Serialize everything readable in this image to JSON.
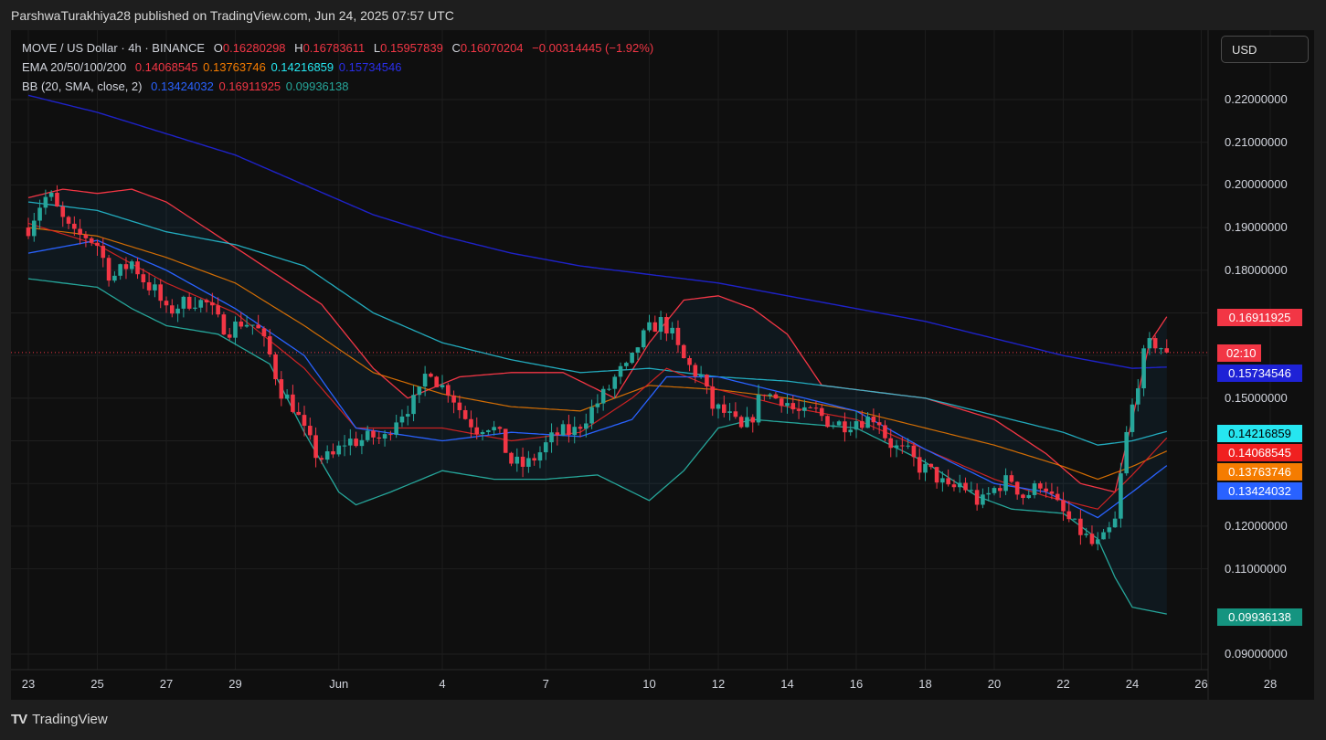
{
  "header": {
    "text": "ParshwaTurakhiya28 published on TradingView.com, Jun 24, 2025 07:57 UTC"
  },
  "legend": {
    "symbol": "MOVE / US Dollar · 4h · BINANCE",
    "open_label": "O",
    "open": "0.16280298",
    "high_label": "H",
    "high": "0.16783611",
    "low_label": "L",
    "low": "0.15957839",
    "close_label": "C",
    "close": "0.16070204",
    "change": "−0.00314445 (−1.92%)",
    "ema_label": "EMA 20/50/100/200",
    "ema20": "0.14068545",
    "ema50": "0.13763746",
    "ema100": "0.14216859",
    "ema200": "0.15734546",
    "bb_label": "BB (20, SMA, close, 2)",
    "bb_basis": "0.13424032",
    "bb_upper": "0.16911925",
    "bb_lower": "0.09936138"
  },
  "currency_button": "USD",
  "footer": {
    "logo": "TV",
    "brand": "TradingView"
  },
  "colors": {
    "background": "#0f0f0f",
    "up": "#26a69a",
    "down": "#f23645",
    "ema20": "#e02424",
    "ema50": "#f57c00",
    "ema100": "#26c6da",
    "ema200": "#1e22c8",
    "bb_basis": "#2962ff",
    "bb_upper": "#f23645",
    "bb_lower": "#26a69a"
  },
  "price_labels": [
    {
      "text": "0.16911925",
      "bg": "#f23645",
      "fg": "#ffffff",
      "value": 0.16911925
    },
    {
      "text": "02:10",
      "bg": "#f23645",
      "fg": "#ffffff",
      "value": 0.1607
    },
    {
      "text": "0.15734546",
      "bg": "#1e22d6",
      "fg": "#ffffff",
      "value": 0.15734546
    },
    {
      "text": "0.14216859",
      "bg": "#26e6f0",
      "fg": "#000000",
      "value": 0.14216859
    },
    {
      "text": "0.14068545",
      "bg": "#f02020",
      "fg": "#ffffff",
      "value": 0.14068545
    },
    {
      "text": "0.13763746",
      "bg": "#f57c00",
      "fg": "#ffffff",
      "value": 0.13763746
    },
    {
      "text": "0.13424032",
      "bg": "#2962ff",
      "fg": "#ffffff",
      "value": 0.13424032
    },
    {
      "text": "0.09936138",
      "bg": "#159480",
      "fg": "#ffffff",
      "value": 0.09936138
    }
  ],
  "chart_data": {
    "type": "candlestick",
    "y_ticks": [
      {
        "value": 0.22,
        "label": "0.22000000"
      },
      {
        "value": 0.21,
        "label": "0.21000000"
      },
      {
        "value": 0.2,
        "label": "0.20000000"
      },
      {
        "value": 0.19,
        "label": "0.19000000"
      },
      {
        "value": 0.18,
        "label": "0.18000000"
      },
      {
        "value": 0.15,
        "label": "0.15000000"
      },
      {
        "value": 0.12,
        "label": "0.12000000"
      },
      {
        "value": 0.11,
        "label": "0.11000000"
      },
      {
        "value": 0.09,
        "label": "0.09000000"
      }
    ],
    "ylim": [
      0.0862,
      0.2267
    ],
    "x_ticks": [
      {
        "day": 0,
        "label": "23"
      },
      {
        "day": 2,
        "label": "25"
      },
      {
        "day": 4,
        "label": "27"
      },
      {
        "day": 6,
        "label": "29"
      },
      {
        "day": 9,
        "label": "Jun"
      },
      {
        "day": 12,
        "label": "4"
      },
      {
        "day": 15,
        "label": "7"
      },
      {
        "day": 18,
        "label": "10"
      },
      {
        "day": 20,
        "label": "12"
      },
      {
        "day": 22,
        "label": "14"
      },
      {
        "day": 24,
        "label": "16"
      },
      {
        "day": 26,
        "label": "18"
      },
      {
        "day": 28,
        "label": "20"
      },
      {
        "day": 30,
        "label": "22"
      },
      {
        "day": 32,
        "label": "24"
      },
      {
        "day": 34,
        "label": "26"
      },
      {
        "day": 36,
        "label": "28"
      }
    ],
    "xlim_days": [
      -0.2,
      38.5
    ],
    "current_price": 0.1607,
    "closes_daily_4h_anchor": [
      [
        0.0,
        0.19
      ],
      [
        0.3,
        0.195
      ],
      [
        0.6,
        0.198
      ],
      [
        0.9,
        0.193
      ],
      [
        1.3,
        0.188
      ],
      [
        1.7,
        0.188
      ],
      [
        2.0,
        0.186
      ],
      [
        2.4,
        0.178
      ],
      [
        2.7,
        0.18
      ],
      [
        3.0,
        0.182
      ],
      [
        3.4,
        0.177
      ],
      [
        3.7,
        0.175
      ],
      [
        4.0,
        0.17
      ],
      [
        4.4,
        0.172
      ],
      [
        4.8,
        0.173
      ],
      [
        5.2,
        0.172
      ],
      [
        5.5,
        0.168
      ],
      [
        5.8,
        0.166
      ],
      [
        6.2,
        0.168
      ],
      [
        6.6,
        0.167
      ],
      [
        7.0,
        0.16
      ],
      [
        7.3,
        0.152
      ],
      [
        7.7,
        0.148
      ],
      [
        8.0,
        0.142
      ],
      [
        8.4,
        0.136
      ],
      [
        8.8,
        0.136
      ],
      [
        9.2,
        0.14
      ],
      [
        9.6,
        0.14
      ],
      [
        10.0,
        0.141
      ],
      [
        10.3,
        0.14
      ],
      [
        10.6,
        0.145
      ],
      [
        11.0,
        0.148
      ],
      [
        11.3,
        0.15
      ],
      [
        11.6,
        0.158
      ],
      [
        11.9,
        0.153
      ],
      [
        12.2,
        0.152
      ],
      [
        12.6,
        0.146
      ],
      [
        13.0,
        0.143
      ],
      [
        13.3,
        0.144
      ],
      [
        13.6,
        0.142
      ],
      [
        14.0,
        0.135
      ],
      [
        14.4,
        0.134
      ],
      [
        14.8,
        0.137
      ],
      [
        15.1,
        0.14
      ],
      [
        15.4,
        0.142
      ],
      [
        15.8,
        0.142
      ],
      [
        16.1,
        0.145
      ],
      [
        16.4,
        0.148
      ],
      [
        16.8,
        0.152
      ],
      [
        17.1,
        0.156
      ],
      [
        17.4,
        0.157
      ],
      [
        17.7,
        0.163
      ],
      [
        18.0,
        0.166
      ],
      [
        18.3,
        0.168
      ],
      [
        18.6,
        0.166
      ],
      [
        18.9,
        0.16
      ],
      [
        19.2,
        0.157
      ],
      [
        19.5,
        0.155
      ],
      [
        19.8,
        0.148
      ],
      [
        20.1,
        0.147
      ],
      [
        20.4,
        0.145
      ],
      [
        20.7,
        0.142
      ],
      [
        21.0,
        0.146
      ],
      [
        21.3,
        0.152
      ],
      [
        21.6,
        0.15
      ],
      [
        21.9,
        0.15
      ],
      [
        22.2,
        0.147
      ],
      [
        22.5,
        0.146
      ],
      [
        22.8,
        0.147
      ],
      [
        23.1,
        0.145
      ],
      [
        23.4,
        0.144
      ],
      [
        23.7,
        0.144
      ],
      [
        24.0,
        0.145
      ],
      [
        24.3,
        0.145
      ],
      [
        24.6,
        0.146
      ],
      [
        24.9,
        0.14
      ],
      [
        25.2,
        0.138
      ],
      [
        25.5,
        0.137
      ],
      [
        25.8,
        0.134
      ],
      [
        26.1,
        0.133
      ],
      [
        26.4,
        0.131
      ],
      [
        26.7,
        0.128
      ],
      [
        27.0,
        0.13
      ],
      [
        27.3,
        0.128
      ],
      [
        27.6,
        0.125
      ],
      [
        27.9,
        0.128
      ],
      [
        28.2,
        0.13
      ],
      [
        28.5,
        0.131
      ],
      [
        28.8,
        0.127
      ],
      [
        29.1,
        0.128
      ],
      [
        29.4,
        0.131
      ],
      [
        29.7,
        0.126
      ],
      [
        30.0,
        0.123
      ],
      [
        30.3,
        0.12
      ],
      [
        30.6,
        0.118
      ],
      [
        30.9,
        0.115
      ],
      [
        31.2,
        0.117
      ],
      [
        31.5,
        0.121
      ],
      [
        31.8,
        0.14
      ],
      [
        32.1,
        0.152
      ],
      [
        32.4,
        0.162
      ],
      [
        32.7,
        0.163
      ],
      [
        33.0,
        0.1607
      ]
    ],
    "ema200": [
      [
        0.0,
        0.221
      ],
      [
        2.0,
        0.217
      ],
      [
        4.0,
        0.212
      ],
      [
        6.0,
        0.207
      ],
      [
        8.0,
        0.2
      ],
      [
        10.0,
        0.193
      ],
      [
        12.0,
        0.188
      ],
      [
        14.0,
        0.184
      ],
      [
        16.0,
        0.181
      ],
      [
        18.0,
        0.179
      ],
      [
        20.0,
        0.177
      ],
      [
        22.0,
        0.174
      ],
      [
        24.0,
        0.171
      ],
      [
        26.0,
        0.168
      ],
      [
        28.0,
        0.164
      ],
      [
        30.0,
        0.16
      ],
      [
        32.0,
        0.157
      ],
      [
        33.0,
        0.1573
      ]
    ],
    "ema100": [
      [
        0.0,
        0.196
      ],
      [
        2.0,
        0.194
      ],
      [
        4.0,
        0.189
      ],
      [
        6.0,
        0.186
      ],
      [
        8.0,
        0.181
      ],
      [
        10.0,
        0.17
      ],
      [
        12.0,
        0.163
      ],
      [
        14.0,
        0.159
      ],
      [
        16.0,
        0.156
      ],
      [
        18.0,
        0.157
      ],
      [
        20.0,
        0.155
      ],
      [
        22.0,
        0.154
      ],
      [
        24.0,
        0.152
      ],
      [
        26.0,
        0.15
      ],
      [
        28.0,
        0.146
      ],
      [
        30.0,
        0.142
      ],
      [
        31.0,
        0.139
      ],
      [
        32.0,
        0.14
      ],
      [
        33.0,
        0.1422
      ]
    ],
    "ema50": [
      [
        0.0,
        0.19
      ],
      [
        2.0,
        0.188
      ],
      [
        4.0,
        0.183
      ],
      [
        6.0,
        0.177
      ],
      [
        8.0,
        0.167
      ],
      [
        10.0,
        0.156
      ],
      [
        12.0,
        0.151
      ],
      [
        14.0,
        0.148
      ],
      [
        16.0,
        0.147
      ],
      [
        18.0,
        0.153
      ],
      [
        20.0,
        0.152
      ],
      [
        22.0,
        0.15
      ],
      [
        24.0,
        0.147
      ],
      [
        26.0,
        0.143
      ],
      [
        28.0,
        0.139
      ],
      [
        30.0,
        0.134
      ],
      [
        31.0,
        0.131
      ],
      [
        32.0,
        0.134
      ],
      [
        33.0,
        0.1376
      ]
    ],
    "ema20": [
      [
        0.0,
        0.191
      ],
      [
        2.0,
        0.186
      ],
      [
        4.0,
        0.177
      ],
      [
        6.0,
        0.17
      ],
      [
        8.0,
        0.157
      ],
      [
        9.5,
        0.143
      ],
      [
        12.0,
        0.143
      ],
      [
        14.0,
        0.14
      ],
      [
        16.0,
        0.142
      ],
      [
        17.5,
        0.15
      ],
      [
        18.5,
        0.157
      ],
      [
        20.0,
        0.152
      ],
      [
        22.0,
        0.148
      ],
      [
        24.0,
        0.145
      ],
      [
        26.0,
        0.138
      ],
      [
        28.0,
        0.131
      ],
      [
        29.5,
        0.127
      ],
      [
        31.0,
        0.124
      ],
      [
        32.0,
        0.132
      ],
      [
        33.0,
        0.1407
      ]
    ],
    "bb_basis": [
      [
        0.0,
        0.184
      ],
      [
        2.0,
        0.187
      ],
      [
        4.0,
        0.18
      ],
      [
        6.0,
        0.171
      ],
      [
        8.0,
        0.16
      ],
      [
        9.5,
        0.143
      ],
      [
        12.0,
        0.14
      ],
      [
        14.0,
        0.142
      ],
      [
        16.0,
        0.141
      ],
      [
        17.5,
        0.145
      ],
      [
        18.5,
        0.155
      ],
      [
        20.0,
        0.155
      ],
      [
        22.0,
        0.151
      ],
      [
        24.0,
        0.147
      ],
      [
        26.0,
        0.138
      ],
      [
        28.0,
        0.13
      ],
      [
        29.5,
        0.128
      ],
      [
        31.0,
        0.122
      ],
      [
        32.0,
        0.128
      ],
      [
        33.0,
        0.1342
      ]
    ],
    "bb_upper": [
      [
        0.0,
        0.197
      ],
      [
        1.0,
        0.199
      ],
      [
        2.0,
        0.198
      ],
      [
        3.0,
        0.199
      ],
      [
        4.0,
        0.196
      ],
      [
        5.5,
        0.188
      ],
      [
        7.0,
        0.18
      ],
      [
        8.5,
        0.172
      ],
      [
        10.0,
        0.157
      ],
      [
        11.0,
        0.15
      ],
      [
        12.5,
        0.155
      ],
      [
        14.0,
        0.156
      ],
      [
        15.5,
        0.156
      ],
      [
        17.0,
        0.15
      ],
      [
        18.0,
        0.163
      ],
      [
        19.0,
        0.173
      ],
      [
        20.0,
        0.174
      ],
      [
        21.0,
        0.171
      ],
      [
        22.0,
        0.165
      ],
      [
        23.0,
        0.153
      ],
      [
        24.0,
        0.152
      ],
      [
        26.0,
        0.15
      ],
      [
        28.0,
        0.145
      ],
      [
        29.5,
        0.137
      ],
      [
        30.5,
        0.13
      ],
      [
        31.5,
        0.128
      ],
      [
        32.0,
        0.145
      ],
      [
        32.5,
        0.163
      ],
      [
        33.0,
        0.1691
      ]
    ],
    "bb_lower": [
      [
        0.0,
        0.178
      ],
      [
        1.0,
        0.177
      ],
      [
        2.0,
        0.176
      ],
      [
        3.0,
        0.171
      ],
      [
        4.0,
        0.167
      ],
      [
        5.5,
        0.165
      ],
      [
        7.0,
        0.158
      ],
      [
        8.0,
        0.142
      ],
      [
        9.0,
        0.128
      ],
      [
        9.5,
        0.125
      ],
      [
        10.5,
        0.128
      ],
      [
        12.0,
        0.133
      ],
      [
        13.5,
        0.131
      ],
      [
        15.0,
        0.131
      ],
      [
        16.5,
        0.132
      ],
      [
        18.0,
        0.126
      ],
      [
        19.0,
        0.133
      ],
      [
        20.0,
        0.143
      ],
      [
        21.0,
        0.145
      ],
      [
        22.5,
        0.144
      ],
      [
        24.0,
        0.143
      ],
      [
        26.0,
        0.135
      ],
      [
        27.5,
        0.127
      ],
      [
        28.5,
        0.124
      ],
      [
        30.0,
        0.123
      ],
      [
        31.0,
        0.117
      ],
      [
        31.5,
        0.108
      ],
      [
        32.0,
        0.101
      ],
      [
        33.0,
        0.0994
      ]
    ]
  }
}
